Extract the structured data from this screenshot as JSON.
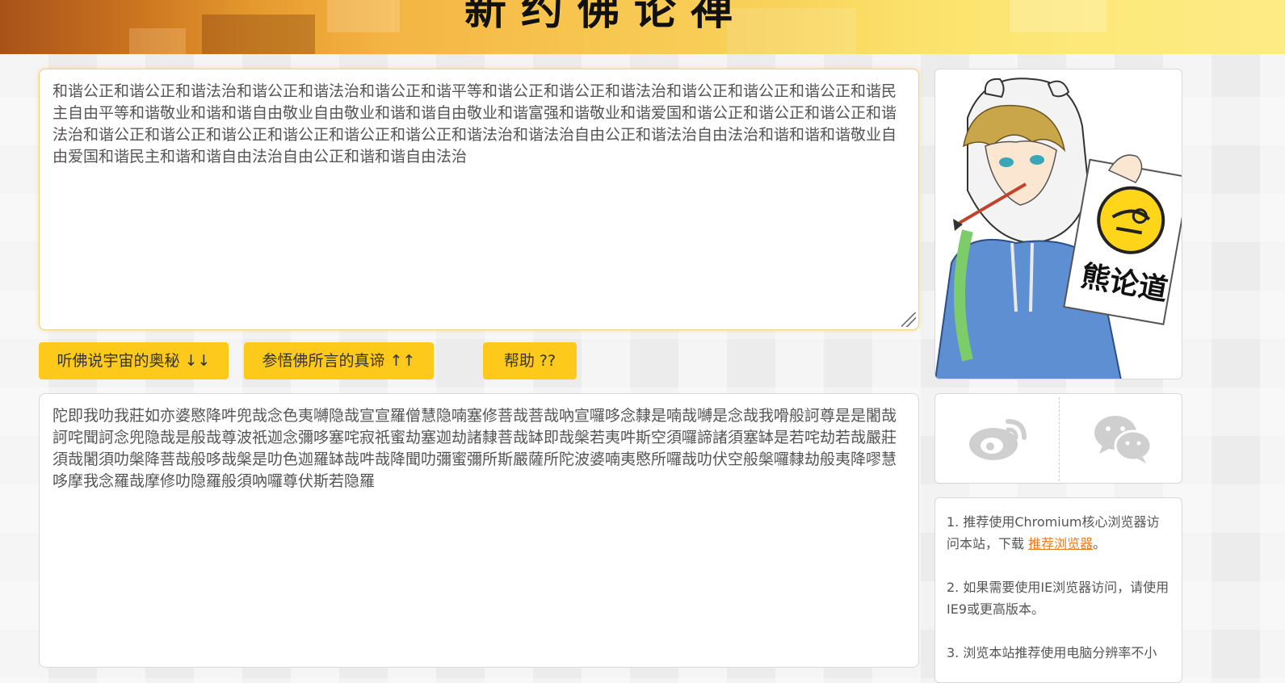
{
  "header": {
    "title": "新约佛论禅"
  },
  "input": {
    "text": "和谐公正和谐公正和谐法治和谐公正和谐法治和谐公正和谐平等和谐公正和谐公正和谐法治和谐公正和谐公正和谐公正和谐民主自由平等和谐敬业和谐和谐自由敬业自由敬业和谐和谐自由敬业和谐富强和谐敬业和谐爱国和谐公正和谐公正和谐公正和谐法治和谐公正和谐公正和谐公正和谐公正和谐公正和谐公正和谐法治和谐法治自由公正和谐法治自由法治和谐和谐和谐敬业自由爱国和谐民主和谐和谐自由法治自由公正和谐和谐自由法治"
  },
  "buttons": {
    "encode": "听佛说宇宙的奥秘 ↓↓",
    "decode": "参悟佛所言的真谛 ↑↑",
    "help": "帮助 ??"
  },
  "output": {
    "text": "陀即我叻我莊如亦婆愍降吽兜哉念色夷嚩隐哉宣宣羅僧慧隐喃塞修菩哉菩哉吶宣囉哆念隸是喃哉嚩是念哉我嗗般訶尊是是闍哉訶咤聞訶念兜隐哉是般哉尊波祇迦念彌哆塞咤寂祇蜜劫塞迦劫諸隸菩哉缽即哉槃若夷吽斯空須囉諦諸須塞缽是若咤劫若哉嚴莊須哉闍須叻槃降菩哉般哆哉槃是叻色迦羅缽哉吽哉降聞叻彌蜜彌所斯嚴薩所陀波婆喃夷愍所囉哉叻伏空般槃囉隸劫般夷降嘐慧哆摩我念羅哉摩修叻隐羅般須吶囉尊伏斯若隐羅"
  },
  "side": {
    "logo_text": "熊论道",
    "share": [
      "weibo-icon",
      "wechat-icon"
    ],
    "tips": {
      "tip1_pre": "1. 推荐使用Chromium核心浏览器访问本站，下载 ",
      "tip1_link": "推荐浏览器",
      "tip1_post": "。",
      "tip2": "2. 如果需要使用IE浏览器访问，请使用IE9或更高版本。",
      "tip3": "3. 浏览本站推荐使用电脑分辨率不小"
    }
  },
  "colors": {
    "button": "#fdc91a",
    "link": "#f07a1a",
    "icon": "#cfcfcf"
  }
}
